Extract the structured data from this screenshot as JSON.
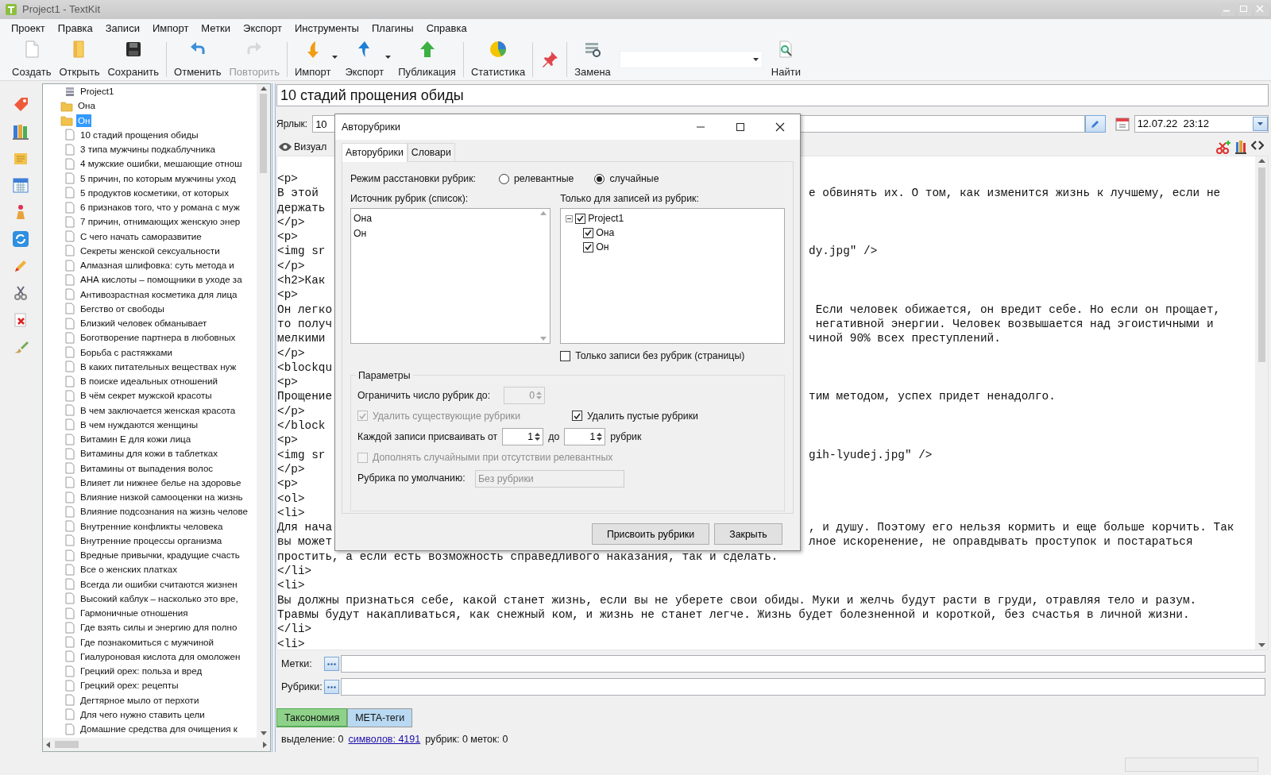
{
  "window": {
    "title": "Project1 - TextKit"
  },
  "menu": [
    "Проект",
    "Правка",
    "Записи",
    "Импорт",
    "Метки",
    "Экспорт",
    "Инструменты",
    "Плагины",
    "Справка"
  ],
  "toolbar": [
    [
      {
        "label": "Создать",
        "kind": "new",
        "disabled": false,
        "dropdown": false
      },
      {
        "label": "Открыть",
        "kind": "open",
        "disabled": false,
        "dropdown": false
      },
      {
        "label": "Сохранить",
        "kind": "save",
        "disabled": false,
        "dropdown": false
      }
    ],
    [
      {
        "label": "Отменить",
        "kind": "undo",
        "disabled": false,
        "dropdown": false
      },
      {
        "label": "Повторить",
        "kind": "redo",
        "disabled": true,
        "dropdown": false
      }
    ],
    [
      {
        "label": "Импорт",
        "kind": "import",
        "disabled": false,
        "dropdown": true
      },
      {
        "label": "Экспорт",
        "kind": "export",
        "disabled": false,
        "dropdown": true
      },
      {
        "label": "Публикация",
        "kind": "publish",
        "disabled": false,
        "dropdown": false
      }
    ],
    [
      {
        "label": "Статистика",
        "kind": "stats",
        "disabled": false,
        "dropdown": false
      }
    ],
    [
      {
        "kind": "pin",
        "disabled": false,
        "dropdown": false
      }
    ],
    [
      {
        "label": "Замена",
        "kind": "replace",
        "disabled": false,
        "dropdown": false
      },
      {
        "kind": "combo",
        "disabled": false,
        "dropdown": true
      },
      {
        "label": "Найти",
        "kind": "find",
        "disabled": false,
        "dropdown": false
      }
    ]
  ],
  "tree": [
    {
      "label": "Project1",
      "kind": "project",
      "selected": false
    },
    {
      "label": "Она",
      "kind": "folder",
      "selected": false
    },
    {
      "label": "Он",
      "kind": "folder",
      "selected": true
    },
    {
      "label": "10 стадий прощения обиды",
      "kind": "document",
      "selected": false
    },
    {
      "label": "3 типа мужчины подкаблучника",
      "kind": "document",
      "selected": false
    },
    {
      "label": "4 мужские ошибки, мешающие отнош",
      "kind": "document",
      "selected": false
    },
    {
      "label": "5 причин, по которым мужчины уход",
      "kind": "document",
      "selected": false
    },
    {
      "label": "5 продуктов косметики, от которых",
      "kind": "document",
      "selected": false
    },
    {
      "label": "6 признаков того, что у романа с муж",
      "kind": "document",
      "selected": false
    },
    {
      "label": "7 причин, отнимающих женскую энер",
      "kind": "document",
      "selected": false
    },
    {
      "label": "С чего начать саморазвитие",
      "kind": "document",
      "selected": false
    },
    {
      "label": "Секреты женской сексуальности",
      "kind": "document",
      "selected": false
    },
    {
      "label": "Алмазная шлифовка: суть метода и",
      "kind": "document",
      "selected": false
    },
    {
      "label": "АНА кислоты – помощники в уходе за",
      "kind": "document",
      "selected": false
    },
    {
      "label": "Антивозрастная косметика для лица",
      "kind": "document",
      "selected": false
    },
    {
      "label": "Бегство от свободы",
      "kind": "document",
      "selected": false
    },
    {
      "label": "Близкий человек обманывает",
      "kind": "document",
      "selected": false
    },
    {
      "label": "Боготворение партнера в любовных",
      "kind": "document",
      "selected": false
    },
    {
      "label": "Борьба с растяжками",
      "kind": "document",
      "selected": false
    },
    {
      "label": "В каких питательных веществах нуж",
      "kind": "document",
      "selected": false
    },
    {
      "label": "В поиске идеальных отношений",
      "kind": "document",
      "selected": false
    },
    {
      "label": "В чём секрет мужской красоты",
      "kind": "document",
      "selected": false
    },
    {
      "label": "В чем заключается женская красота",
      "kind": "document",
      "selected": false
    },
    {
      "label": "В чем нуждаются женщины",
      "kind": "document",
      "selected": false
    },
    {
      "label": "Витамин Е для кожи лица",
      "kind": "document",
      "selected": false
    },
    {
      "label": "Витамины для кожи в таблетках",
      "kind": "document",
      "selected": false
    },
    {
      "label": "Витамины от выпадения волос",
      "kind": "document",
      "selected": false
    },
    {
      "label": "Влияет ли нижнее белье на здоровье",
      "kind": "document",
      "selected": false
    },
    {
      "label": "Влияние низкой самооценки на жизнь",
      "kind": "document",
      "selected": false
    },
    {
      "label": "Влияние подсознания на жизнь челове",
      "kind": "document",
      "selected": false
    },
    {
      "label": "Внутренние конфликты человека",
      "kind": "document",
      "selected": false
    },
    {
      "label": "Внутренние процессы организма",
      "kind": "document",
      "selected": false
    },
    {
      "label": "Вредные привычки, крадущие счасть",
      "kind": "document",
      "selected": false
    },
    {
      "label": "Все о женских платках",
      "kind": "document",
      "selected": false
    },
    {
      "label": "Всегда ли ошибки считаются жизнен",
      "kind": "document",
      "selected": false
    },
    {
      "label": "Высокий каблук – насколько это вре,",
      "kind": "document",
      "selected": false
    },
    {
      "label": "Гармоничные отношения",
      "kind": "document",
      "selected": false
    },
    {
      "label": "Где взять силы и энергию для полно",
      "kind": "document",
      "selected": false
    },
    {
      "label": "Где познакомиться с мужчиной",
      "kind": "document",
      "selected": false
    },
    {
      "label": "Гиалуроновая кислота для омоложен",
      "kind": "document",
      "selected": false
    },
    {
      "label": "Грецкий орех: польза и вред",
      "kind": "document",
      "selected": false
    },
    {
      "label": "Грецкий орех: рецепты",
      "kind": "document",
      "selected": false
    },
    {
      "label": "Дегтярное мыло от перхоти",
      "kind": "document",
      "selected": false
    },
    {
      "label": "Для чего нужно ставить цели",
      "kind": "document",
      "selected": false
    },
    {
      "label": "Домашние средства для очищения к",
      "kind": "document",
      "selected": false
    }
  ],
  "document": {
    "title": "10 стадий прощения обиды",
    "label_caption": "Ярлык:",
    "label_value": "10",
    "date": "12.07.22  23:12",
    "view_tab": "Визуал"
  },
  "editor": {
    "lines": [
      {
        "left": "<p>"
      },
      {
        "left": "В этой",
        "right": "е обвинять их. О том, как изменится жизнь к лучшему, если не"
      },
      {
        "left": "держать"
      },
      {
        "left": "</p>"
      },
      {
        "left": "<p>"
      },
      {
        "left": "<img sr",
        "right": "dy.jpg\" />"
      },
      {
        "left": "</p>"
      },
      {
        "left": "<h2>Как"
      },
      {
        "left": "<p>"
      },
      {
        "left": "Он легко",
        "right": " Если человек обижается, он вредит себе. Но если он прощает,"
      },
      {
        "left": "то получ",
        "right": " негативной энергии. Человек возвышается над эгоистичными и"
      },
      {
        "left": "мелкими",
        "right": "чиной 90% всех преступлений."
      },
      {
        "left": "</p>"
      },
      {
        "left": "<blockqu"
      },
      {
        "left": "<p>"
      },
      {
        "left": "Прощение",
        "right": "тим методом, успех придет ненадолго."
      },
      {
        "left": "</p>"
      },
      {
        "left": "</block"
      },
      {
        "left": "<p>"
      },
      {
        "left": "<img sr",
        "right": "gih-lyudej.jpg\" />"
      },
      {
        "left": "</p>"
      },
      {
        "left": "<p>"
      },
      {
        "left": "<ol>"
      },
      {
        "left": "<li>"
      },
      {
        "left": "Для нача",
        "right": ", и душу. Поэтому его нельзя кормить и еще больше корчить. Так"
      },
      {
        "left": "вы может",
        "right": "лное искоренение, не оправдывать проступок и постараться"
      },
      {
        "left": "простить, а если есть возможность справедливого наказания, так и сделать."
      },
      {
        "left": "</li>"
      },
      {
        "left": "<li>"
      },
      {
        "left": "Вы должны признаться себе, какой станет жизнь, если вы не уберете свои обиды. Муки и желчь будут расти в груди, отравляя тело и разум."
      },
      {
        "left": "Травмы будут накапливаться, как снежный ком, и жизнь не станет легче. Жизнь будет болезненной и короткой, без счастья в личной жизни."
      },
      {
        "left": "</li>"
      },
      {
        "left": "<li>"
      }
    ]
  },
  "fields": [
    {
      "label": "Метки:"
    },
    {
      "label": "Рубрики:"
    }
  ],
  "bottom_tabs": [
    {
      "label": "Таксономия",
      "selected": true,
      "color": "#8ed28a"
    },
    {
      "label": "META-теги",
      "selected": false,
      "color": "#b9d9f2"
    }
  ],
  "status": {
    "selection": "выделение: 0",
    "chars": "символов: 4191",
    "counts": "рубрик: 0 меток: 0"
  },
  "dialog": {
    "title": "Авторубрики",
    "tabs": [
      {
        "label": "Авторубрики",
        "selected": true
      },
      {
        "label": "Словари",
        "selected": false
      }
    ],
    "mode": {
      "label": "Режим расстановки рубрик:",
      "options": [
        {
          "label": "релевантные",
          "selected": false
        },
        {
          "label": "случайные",
          "selected": true
        }
      ]
    },
    "source": {
      "label": "Источник рубрик (список):",
      "items": [
        "Она",
        "Он"
      ]
    },
    "filter": {
      "label": "Только для записей из рубрик:",
      "tree": [
        {
          "label": "Project1",
          "checked": true,
          "expanded": true,
          "children": [
            {
              "label": "Она",
              "checked": true
            },
            {
              "label": "Он",
              "checked": true
            }
          ]
        }
      ]
    },
    "only_without": {
      "label": "Только записи без рубрик (страницы)",
      "checked": false,
      "disabled": false
    },
    "params": {
      "title": "Параметры",
      "limit": {
        "label": "Ограничить число рубрик до:",
        "value": "0",
        "disabled": true
      },
      "delete_existing": {
        "label": "Удалить существующие рубрики",
        "checked": true,
        "disabled": true
      },
      "delete_empty": {
        "label": "Удалить пустые рубрики",
        "checked": true,
        "disabled": false
      },
      "range": {
        "label": "Каждой записи присваивать от",
        "from": "1",
        "to_label": "до",
        "to": "1",
        "suffix": "рубрик"
      },
      "fill_random": {
        "label": "Дополнять случайными при отсутствии релевантных",
        "checked": false,
        "disabled": true
      },
      "default": {
        "label": "Рубрика по умолчанию:",
        "value": "Без рубрики",
        "disabled": true
      }
    },
    "buttons": [
      "Присвоить рубрики",
      "Закрыть"
    ]
  }
}
